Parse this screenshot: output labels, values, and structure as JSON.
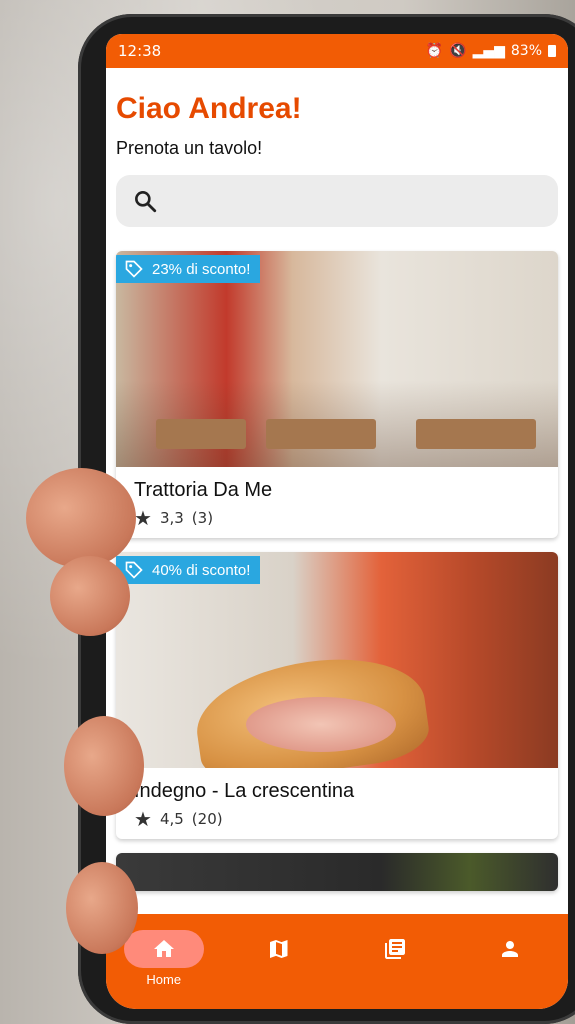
{
  "status_bar": {
    "time": "12:38",
    "battery": "83%"
  },
  "header": {
    "greeting": "Ciao Andrea!",
    "subtitle": "Prenota un tavolo!"
  },
  "search": {
    "placeholder": ""
  },
  "restaurants": [
    {
      "discount": "23% di sconto!",
      "name": "Trattoria Da Me",
      "rating": "3,3",
      "reviews": "(3)"
    },
    {
      "discount": "40% di sconto!",
      "name": "Indegno - La crescentina",
      "rating": "4,5",
      "reviews": "(20)"
    }
  ],
  "nav": {
    "items": [
      {
        "label": "Home",
        "icon": "home-icon",
        "active": true
      },
      {
        "label": "",
        "icon": "map-icon",
        "active": false
      },
      {
        "label": "",
        "icon": "library-icon",
        "active": false
      },
      {
        "label": "",
        "icon": "person-icon",
        "active": false
      }
    ]
  },
  "colors": {
    "primary": "#f25c05",
    "greeting": "#e64a00",
    "badge": "#2aa7e0",
    "nav_active": "#ff8a7a"
  }
}
